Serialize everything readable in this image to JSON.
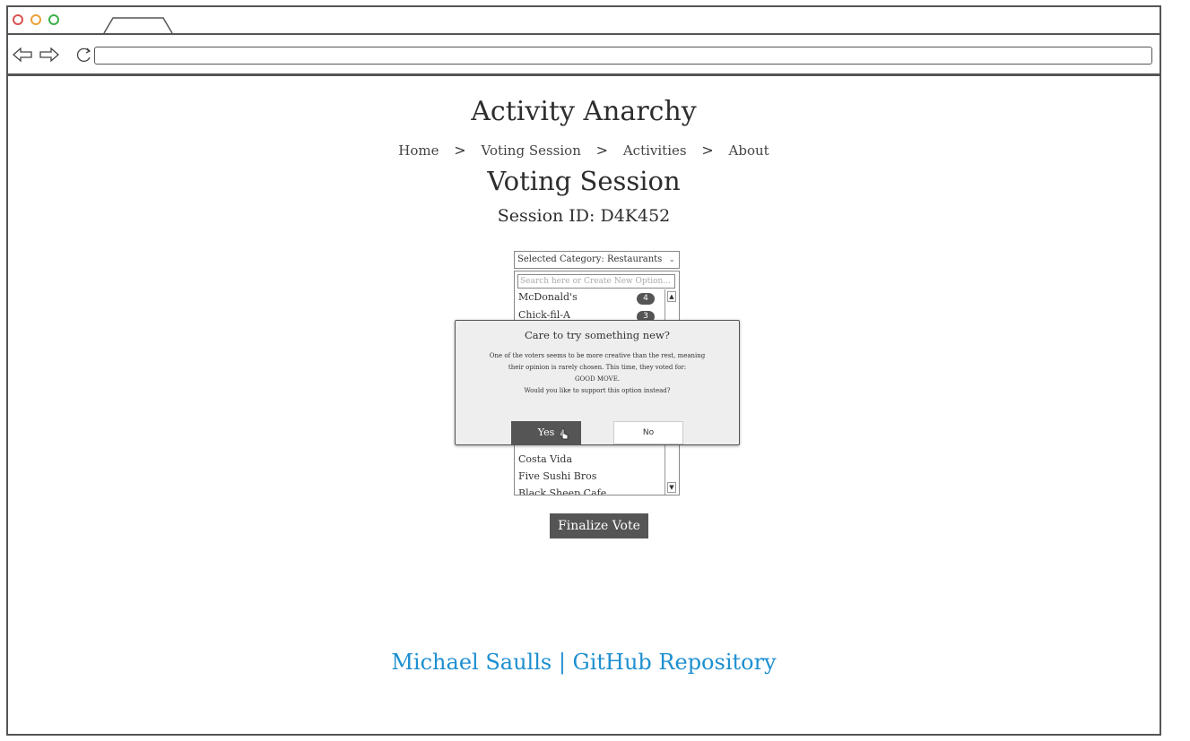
{
  "browser": {
    "window_controls": {
      "close_color": "#d9534f",
      "minimize_color": "#e8a23a",
      "maximize_color": "#3cb04a"
    },
    "url": ""
  },
  "app": {
    "title": "Activity Anarchy",
    "breadcrumb": [
      "Home",
      "Voting Session",
      "Activities",
      "About"
    ],
    "breadcrumb_separator": ">"
  },
  "session": {
    "page_title": "Voting Session",
    "session_id": "Session ID: D4K452"
  },
  "category": {
    "selected": "Selected Category: Restaurants"
  },
  "search": {
    "placeholder": "Search here or Create New Option..."
  },
  "options": {
    "visible_top": [
      {
        "name": "McDonald's",
        "votes": "4"
      },
      {
        "name": "Chick-fil-A",
        "votes": "3"
      }
    ],
    "visible_bottom": [
      {
        "name": "Costa Vida"
      },
      {
        "name": "Five Sushi Bros"
      },
      {
        "name": "Black Sheep Cafe"
      }
    ]
  },
  "finalize": {
    "label": "Finalize Vote"
  },
  "modal": {
    "title": "Care to try something new?",
    "body_line1": "One of the voters seems to be more creative than the rest, meaning",
    "body_line2": "their opinion is rarely chosen. This time, they voted for:",
    "body_option": "GOOD MOVE.",
    "body_line4": "Would you like to support this option instead?",
    "yes_label": "Yes",
    "no_label": "No"
  },
  "footer": {
    "link_text": "Michael Saulls | GitHub Repository",
    "link_color": "#1d8fd0"
  },
  "colors": {
    "accent_dark": "#555555",
    "link": "#1d8fd0"
  }
}
